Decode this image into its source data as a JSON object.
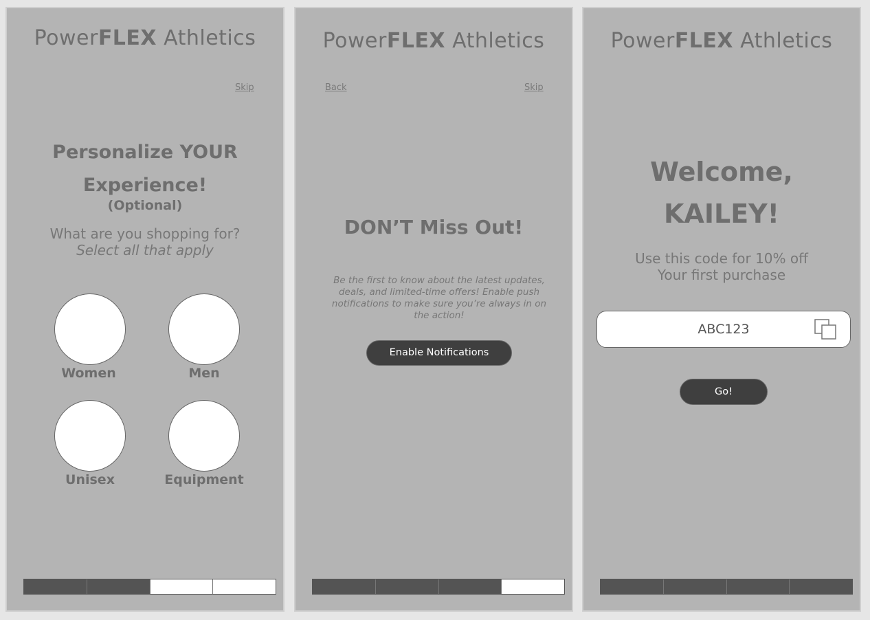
{
  "brand": {
    "prefix": "Power",
    "bold": "FLEX",
    "suffix": "Athletics"
  },
  "screen1": {
    "skip_label": "Skip",
    "heading_line1": "Personalize YOUR",
    "heading_line2": "Experience!",
    "optional": "(Optional)",
    "question": "What are you shopping for?",
    "instruction": "Select all that apply",
    "choices": [
      "Women",
      "Men",
      "Unisex",
      "Equipment"
    ],
    "progress": [
      true,
      true,
      false,
      false
    ]
  },
  "screen2": {
    "back_label": "Back",
    "skip_label": "Skip",
    "heading": "DON’T Miss Out!",
    "body": "Be the first to know about the latest updates, deals, and limited-time offers! Enable push notifications to make sure you’re always in on the action!",
    "button_label": "Enable Notifications",
    "progress": [
      true,
      true,
      true,
      false
    ]
  },
  "screen3": {
    "heading_line1": "Welcome,",
    "heading_line2": "KAILEY!",
    "line1": "Use this code for 10% off",
    "line2": "Your first purchase",
    "code": "ABC123",
    "button_label": "Go!",
    "icon": "copy-icon",
    "progress": [
      true,
      true,
      true,
      true
    ]
  }
}
